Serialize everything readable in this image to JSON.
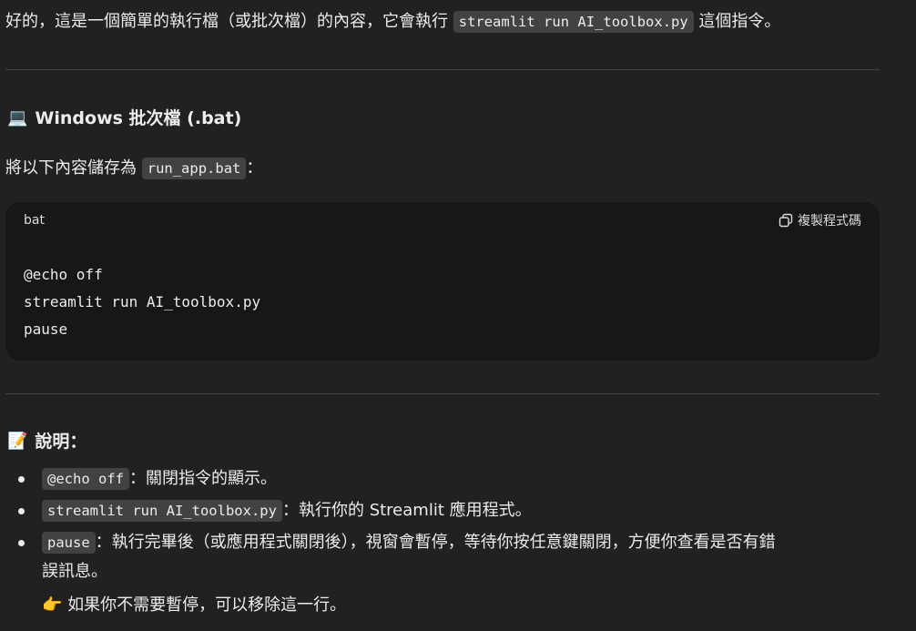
{
  "intro": {
    "text_before": "好的，這是一個簡單的執行檔（或批次檔）的內容，它會執行 ",
    "command": "streamlit run AI_toolbox.py",
    "text_after": " 這個指令。"
  },
  "windows_section": {
    "emoji": "💻",
    "title": "Windows 批次檔 (.bat)",
    "save_text_before": "將以下內容儲存為 ",
    "filename": "run_app.bat",
    "save_text_after": "："
  },
  "code_block": {
    "language": "bat",
    "copy_label": "複製程式碼",
    "lines": [
      "@echo off",
      "streamlit run AI_toolbox.py",
      "pause"
    ]
  },
  "explanation_section": {
    "emoji": "📝",
    "title": "說明：",
    "items": [
      {
        "code": "@echo off",
        "text": "：關閉指令的顯示。"
      },
      {
        "code": "streamlit run AI_toolbox.py",
        "text": "：執行你的 Streamlit 應用程式。"
      },
      {
        "code": "pause",
        "text": "：執行完畢後（或應用程式關閉後），視窗會暫停，等待你按任意鍵關閉，方便你查看是否有錯",
        "text_cont": "誤訊息。"
      }
    ],
    "tip_emoji": "👉",
    "tip_text": "如果你不需要暫停，可以移除這一行。"
  },
  "colors": {
    "background": "#212121",
    "code_block_bg": "#171717",
    "inline_code_bg": "#424242",
    "text": "#ececec"
  }
}
